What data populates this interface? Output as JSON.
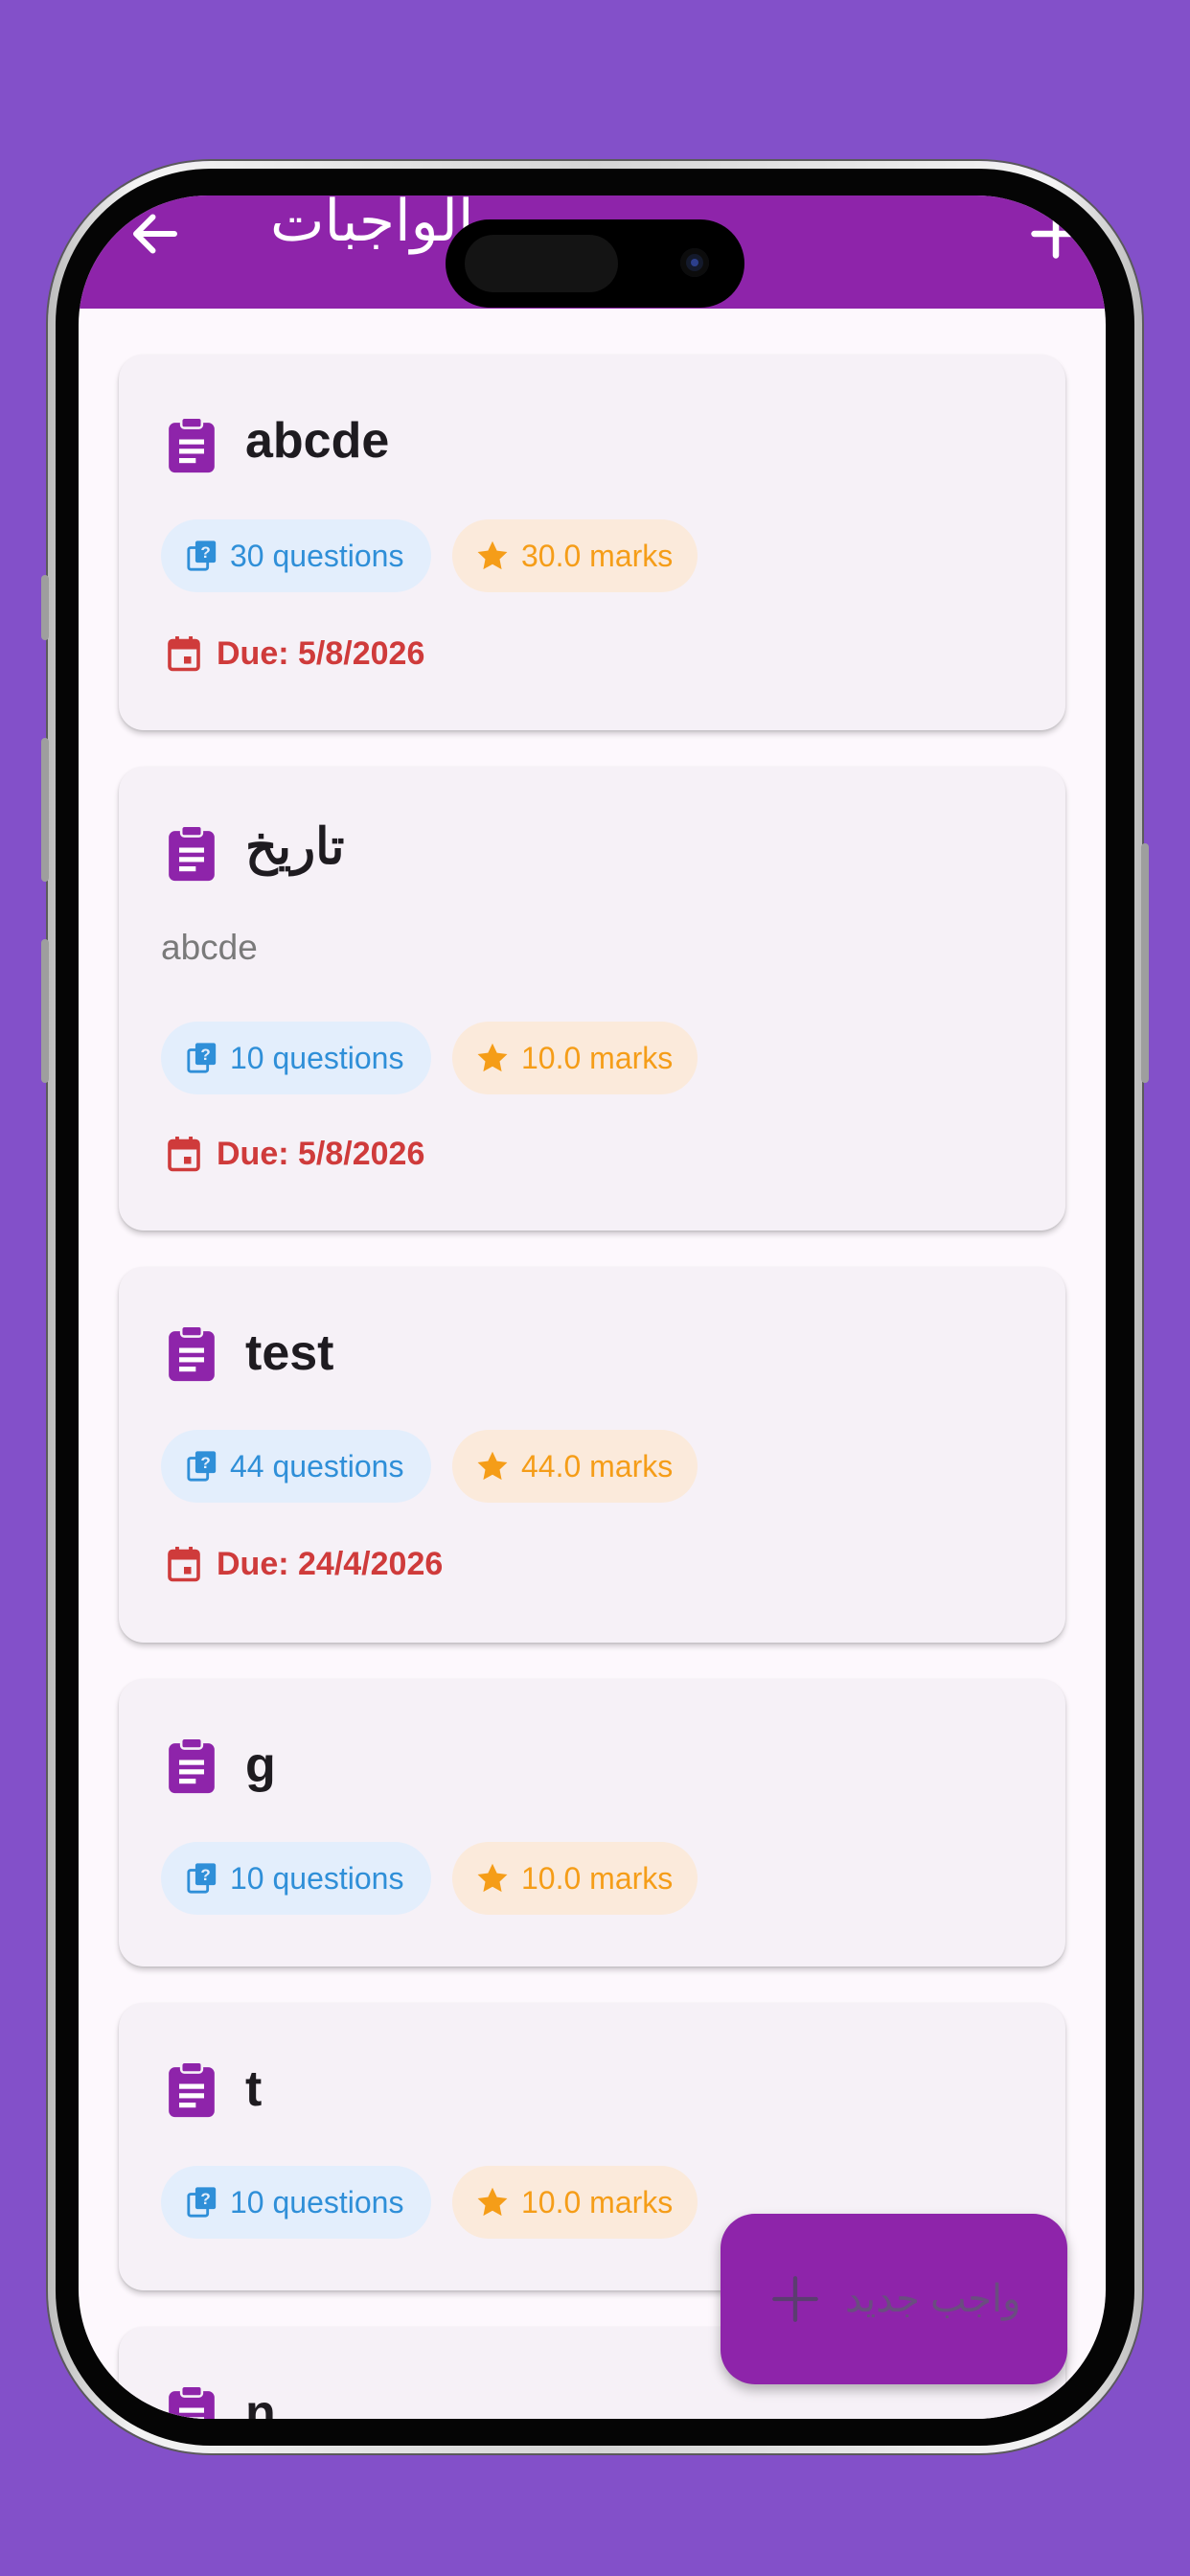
{
  "appbar": {
    "title": "الواجبات",
    "back_icon": "arrow-back-icon",
    "add_icon": "add-icon",
    "color": "#8e24aa"
  },
  "assignments": [
    {
      "title": "abcde",
      "description": null,
      "questions_label": "30 questions",
      "marks_label": "30.0 marks",
      "due_label": "Due: 5/8/2026"
    },
    {
      "title": "تاريخ",
      "description": "abcde",
      "questions_label": "10 questions",
      "marks_label": "10.0 marks",
      "due_label": "Due: 5/8/2026"
    },
    {
      "title": "test",
      "description": null,
      "questions_label": "44 questions",
      "marks_label": "44.0 marks",
      "due_label": "Due: 24/4/2026"
    },
    {
      "title": "g",
      "description": null,
      "questions_label": "10 questions",
      "marks_label": "10.0 marks",
      "due_label": null
    },
    {
      "title": "t",
      "description": null,
      "questions_label": "10 questions",
      "marks_label": "10.0 marks",
      "due_label": null
    },
    {
      "title": "n",
      "description": null,
      "questions_label": null,
      "marks_label": null,
      "due_label": null
    }
  ],
  "fab": {
    "label": "واجب جديد",
    "icon": "add-icon"
  },
  "colors": {
    "background": "#8350c9",
    "accent": "#8e24aa",
    "questions_chip": "#2f8fd8",
    "marks_chip": "#f59d18",
    "due": "#cf3b3b"
  }
}
